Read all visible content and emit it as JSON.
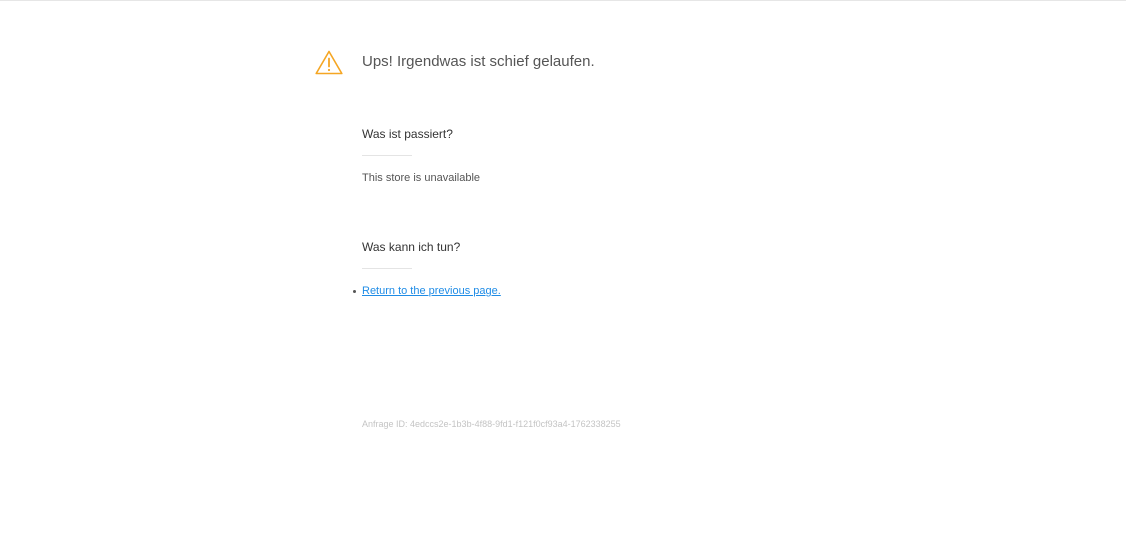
{
  "headline": "Ups! Irgendwas ist schief gelaufen.",
  "icon": "warning-triangle-icon",
  "accent_color": "#f5a623",
  "what_happened": {
    "title": "Was ist passiert?",
    "text": "This store is unavailable"
  },
  "what_can_i_do": {
    "title": "Was kann ich tun?",
    "link": "Return to the previous page."
  },
  "request_id": "Anfrage ID: 4edccs2e-1b3b-4f88-9fd1-f121f0cf93a4-1762338255"
}
